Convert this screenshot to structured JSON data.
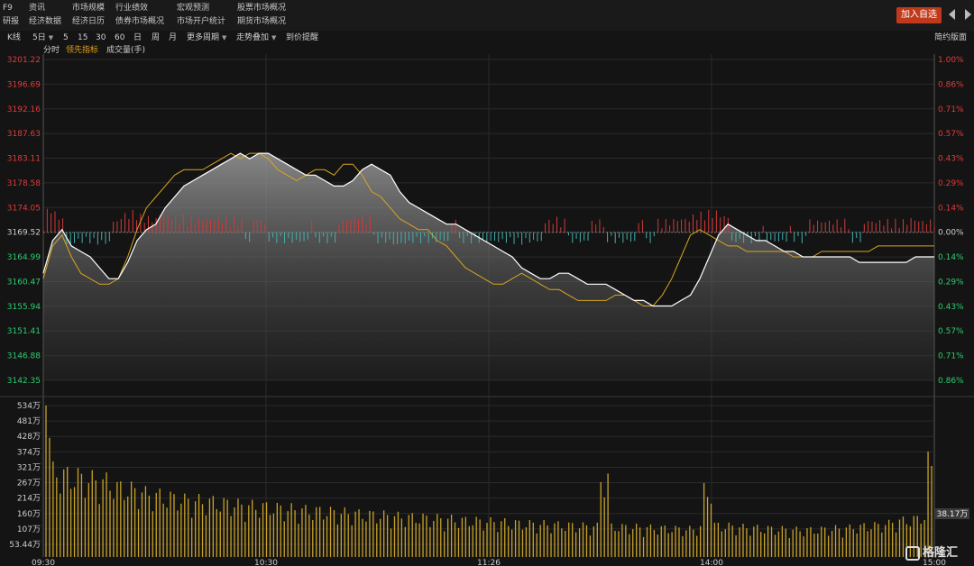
{
  "nav": {
    "col1": [
      "F9",
      "研报"
    ],
    "col2": [
      "资讯",
      "经济数据"
    ],
    "col3": [
      "市场规模",
      "经济日历"
    ],
    "col4": [
      "行业绩效",
      "债券市场概况"
    ],
    "col5": [
      "宏观预测",
      "市场开户统计"
    ],
    "col6": [
      "股票市场概况",
      "期货市场概况"
    ],
    "add_favorite": "加入自选"
  },
  "toolbar": {
    "kline": "K线",
    "period_5day": "5日",
    "p5": "5",
    "p15": "15",
    "p30": "30",
    "p60": "60",
    "day": "日",
    "week": "周",
    "month": "月",
    "more_periods": "更多周期",
    "overlay": "走势叠加",
    "price_alert": "到价提醒",
    "simple_layout": "简约版面"
  },
  "subtoolbar": {
    "timeshare": "分时",
    "leading_indicator": "领先指标",
    "volume": "成交量(手)"
  },
  "colors": {
    "background": "#141414",
    "up": "#e03b3b",
    "down": "#2ecc71",
    "price_line": "#ffffff",
    "lead_line": "#d9a520",
    "volume_bar": "#c9a227",
    "grid": "#2a2a2a",
    "accent_button": "#c0391b"
  },
  "chart_data": {
    "type": "line",
    "base_price": 3169.52,
    "price_axis_ticks": [
      "3201.22",
      "3196.69",
      "3192.16",
      "3187.63",
      "3183.11",
      "3178.58",
      "3174.05",
      "3169.52",
      "3164.99",
      "3160.47",
      "3155.94",
      "3151.41",
      "3146.88",
      "3142.35"
    ],
    "pct_axis_ticks": [
      "1.00%",
      "0.86%",
      "0.71%",
      "0.57%",
      "0.43%",
      "0.29%",
      "0.14%",
      "0.00%",
      "0.14%",
      "0.29%",
      "0.43%",
      "0.57%",
      "0.71%",
      "0.86%"
    ],
    "ylim": [
      3142.35,
      3201.22
    ],
    "volume_axis_ticks": [
      "534万",
      "481万",
      "428万",
      "374万",
      "321万",
      "267万",
      "214万",
      "160万",
      "107万",
      "53.44万"
    ],
    "volume_current_label": "38.17万",
    "x_ticks": [
      "09:30",
      "10:30",
      "11:26",
      "14:00",
      "15:00"
    ],
    "series": [
      {
        "values": [
          3162,
          3168,
          3170,
          3167,
          3166,
          3165,
          3163,
          3161,
          3161,
          3164,
          3168,
          3170,
          3171,
          3174,
          3176,
          3178,
          3179,
          3180,
          3181,
          3182,
          3183,
          3184,
          3183,
          3184,
          3184,
          3183,
          3182,
          3181,
          3180,
          3180,
          3179,
          3178,
          3178,
          3179,
          3181,
          3182,
          3181,
          3180,
          3177,
          3175,
          3174,
          3173,
          3172,
          3171,
          3171,
          3170,
          3169,
          3168,
          3167,
          3166,
          3165,
          3163,
          3162,
          3161,
          3161,
          3162,
          3162,
          3161,
          3160,
          3160,
          3160,
          3159,
          3158,
          3157,
          3157,
          3156,
          3156,
          3156,
          3157,
          3158,
          3161,
          3165,
          3169,
          3171,
          3170,
          3169,
          3168,
          3168,
          3167,
          3166,
          3166,
          3165,
          3165,
          3165,
          3165,
          3165,
          3165,
          3164,
          3164,
          3164,
          3164,
          3164,
          3164,
          3165,
          3165,
          3165
        ]
      },
      {
        "values": [
          3161,
          3167,
          3169,
          3165,
          3162,
          3161,
          3160,
          3160,
          3161,
          3165,
          3170,
          3174,
          3176,
          3178,
          3180,
          3181,
          3181,
          3181,
          3182,
          3183,
          3184,
          3183,
          3184,
          3184,
          3183,
          3181,
          3180,
          3179,
          3180,
          3181,
          3181,
          3180,
          3182,
          3182,
          3180,
          3177,
          3176,
          3174,
          3172,
          3171,
          3170,
          3170,
          3168,
          3167,
          3165,
          3163,
          3162,
          3161,
          3160,
          3160,
          3161,
          3162,
          3161,
          3160,
          3159,
          3159,
          3158,
          3157,
          3157,
          3157,
          3157,
          3158,
          3158,
          3157,
          3156,
          3156,
          3158,
          3161,
          3165,
          3169,
          3170,
          3169,
          3168,
          3167,
          3167,
          3166,
          3166,
          3166,
          3166,
          3166,
          3165,
          3165,
          3165,
          3166,
          3166,
          3166,
          3166,
          3166,
          3166,
          3167,
          3167,
          3167,
          3167,
          3167,
          3167,
          3167
        ]
      }
    ],
    "volume_values": [
      374,
      270,
      260,
      255,
      250,
      245,
      240,
      230,
      220,
      215,
      210,
      200,
      195,
      190,
      185,
      180,
      178,
      176,
      175,
      170,
      168,
      165,
      162,
      160,
      158,
      155,
      152,
      150,
      148,
      146,
      145,
      143,
      140,
      138,
      136,
      134,
      132,
      130,
      128,
      126,
      125,
      123,
      122,
      120,
      118,
      116,
      115,
      113,
      112,
      110,
      108,
      106,
      105,
      104,
      103,
      102,
      100,
      99,
      98,
      97,
      250,
      96,
      95,
      94,
      93,
      92,
      91,
      90,
      89,
      88,
      95,
      210,
      100,
      98,
      96,
      94,
      92,
      90,
      89,
      88,
      87,
      86,
      86,
      87,
      88,
      90,
      92,
      95,
      98,
      100,
      105,
      110,
      115,
      120,
      130,
      300
    ]
  },
  "logo_text": "格隆汇"
}
